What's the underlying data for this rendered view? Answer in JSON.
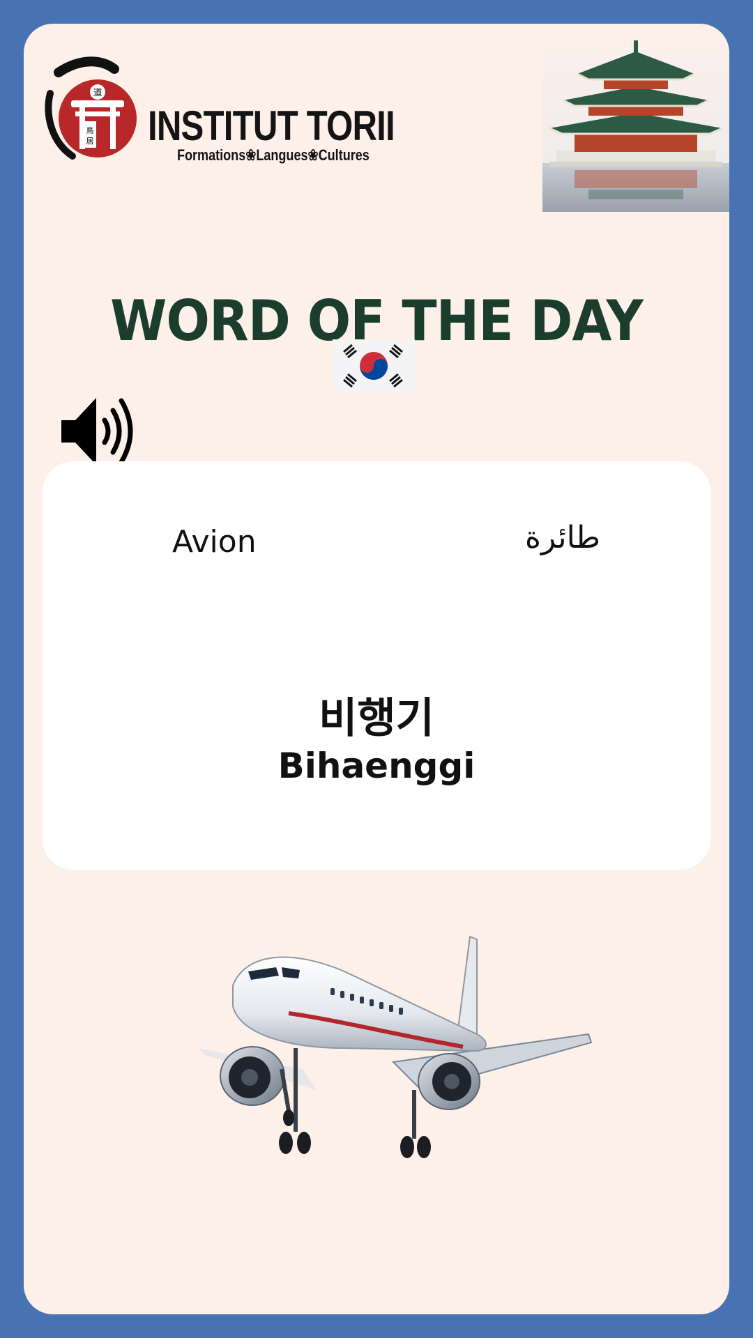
{
  "brand": {
    "name": "INSTITUT TORII",
    "tagline": "Formations❀Langues❀Cultures",
    "seal_glyph_top": "道",
    "seal_glyph_side": "鳥居"
  },
  "headline": "WORD OF THE DAY",
  "flag": {
    "country": "South Korea",
    "icon": "korean-flag-icon"
  },
  "audio": {
    "icon": "speaker-volume-icon"
  },
  "word": {
    "french": "Avion",
    "arabic": "طائرة",
    "korean": "비행기",
    "romanization": "Bihaenggi"
  },
  "illustrations": {
    "top_right": "korean-pagoda-image",
    "bottom": "airplane-image"
  },
  "colors": {
    "border": "#4773b2",
    "card": "#fdf0e9",
    "headline": "#1b3e2c",
    "logo_red": "#b8272a",
    "panel": "#ffffff"
  }
}
